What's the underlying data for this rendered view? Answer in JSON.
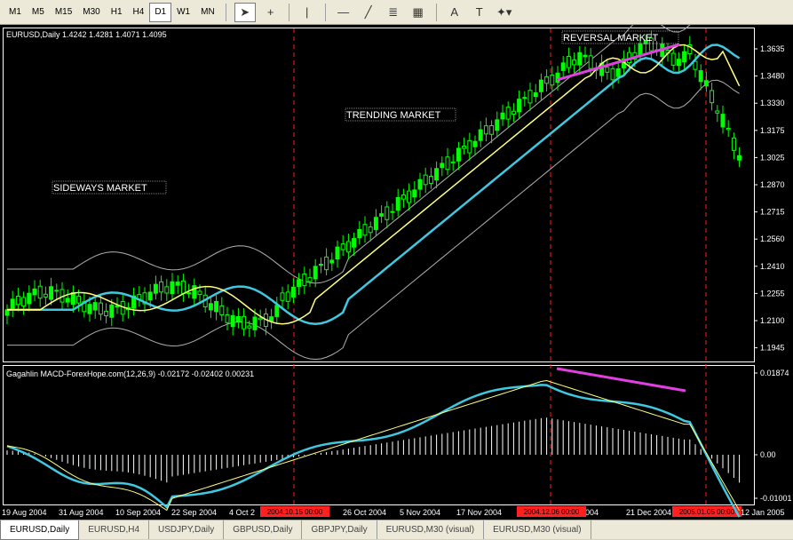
{
  "toolbar": {
    "timeframes": [
      "M1",
      "M5",
      "M15",
      "M30",
      "H1",
      "H4",
      "D1",
      "W1",
      "MN"
    ],
    "active_timeframe": "D1",
    "tools": [
      {
        "name": "cursor-icon",
        "glyph": "➤"
      },
      {
        "name": "crosshair-icon",
        "glyph": "+"
      },
      {
        "name": "vertical-line-icon",
        "glyph": "|"
      },
      {
        "name": "horizontal-line-icon",
        "glyph": "—"
      },
      {
        "name": "trendline-icon",
        "glyph": "╱"
      },
      {
        "name": "fibonacci-icon",
        "glyph": "≣"
      },
      {
        "name": "channel-icon",
        "glyph": "▦"
      },
      {
        "name": "text-icon",
        "glyph": "A"
      },
      {
        "name": "text-label-icon",
        "glyph": "T"
      },
      {
        "name": "shapes-menu-icon",
        "glyph": "✦▾"
      }
    ]
  },
  "chart": {
    "header": "EURUSD,Daily  1.4242 1.4281 1.4071 1.4095",
    "annotations": [
      "SIDEWAYS MARKET",
      "TRENDING MARKET",
      "REVERSAL MARKET"
    ],
    "price_axis": [
      "1.3635",
      "1.3480",
      "1.3330",
      "1.3175",
      "1.3025",
      "1.2870",
      "1.2715",
      "1.2560",
      "1.2410",
      "1.2255",
      "1.2100",
      "1.1945"
    ],
    "indicator_header": "Gagahlin MACD-ForexHope.com(12,26,9) -0.02172 -0.02402 0.00231",
    "indicator_axis": [
      "0.01874",
      "0.00",
      "-0.01001"
    ],
    "date_axis": [
      "19 Aug 2004",
      "31 Aug 2004",
      "10 Sep 2004",
      "22 Sep 2004",
      "4 Oct 2",
      "26 Oct 2004",
      "5 Nov 2004",
      "17 Nov 2004",
      "ec 2004",
      "21 Dec 2004",
      "12 Jan 2005"
    ],
    "marker_dates": [
      "2004.10.15 00:00",
      "2004.12.06 00:00",
      "2005.01.05 00:00"
    ],
    "colors": {
      "background": "#000000",
      "candle": "#00ff00",
      "ma_fast": "#ffff80",
      "ma_mid": "#40c8e0",
      "envelope": "#b0b0b0",
      "divergence": "#e040e0",
      "marker": "#ff2020"
    }
  },
  "tabs": [
    "EURUSD,Daily",
    "EURUSD,H4",
    "USDJPY,Daily",
    "GBPUSD,Daily",
    "GBPJPY,Daily",
    "EURUSD,M30 (visual)",
    "EURUSD,M30 (visual)"
  ],
  "active_tab": "EURUSD,Daily"
}
